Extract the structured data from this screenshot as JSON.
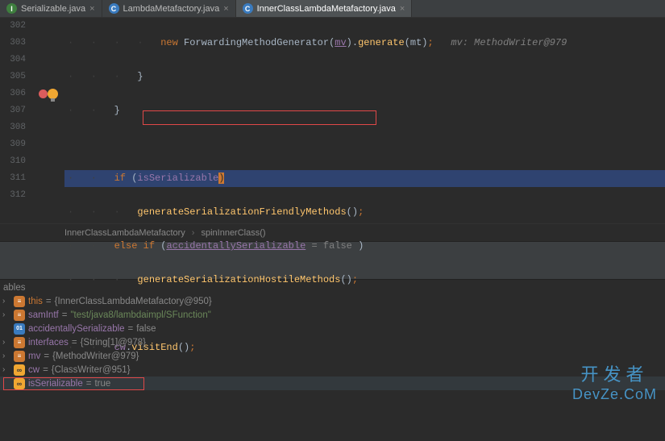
{
  "tabs": [
    {
      "label": "Serializable.java",
      "iconLetter": "I"
    },
    {
      "label": "LambdaMetafactory.java",
      "iconLetter": "C"
    },
    {
      "label": "InnerClassLambdaMetafactory.java",
      "iconLetter": "C"
    }
  ],
  "lines": {
    "l302": "302",
    "l303": "303",
    "l304": "304",
    "l305": "305",
    "l306": "306",
    "l307": "307",
    "l308": "308",
    "l309": "309",
    "l310": "310",
    "l311": "311",
    "l312": "312"
  },
  "code": {
    "newKw": "new",
    "fwdMethodGen": "ForwardingMethodGenerator",
    "mvVar": "mv",
    "generate": "generate",
    "mtVar": "mt",
    "mvComment": "mv: MethodWriter@979",
    "ifKw": "if",
    "isSerializable": "isSerializable",
    "genFriendly": "generateSerializationFriendlyMethods",
    "elseKw": "else",
    "accSerial": "accidentallySerializable",
    "falseLit": " = false ",
    "genHostile": "generateSerializationHostileMethods",
    "cwVar": "cw",
    "visitEnd": "visitEnd"
  },
  "breadcrumb": {
    "cls": "InnerClassLambdaMetafactory",
    "method": "spinInnerClass()"
  },
  "debug": {
    "header": "ables",
    "rows": [
      {
        "exp": true,
        "icon": "group",
        "iconTxt": "≡",
        "nameCls": "this",
        "name": "this",
        "eq": " = ",
        "valCls": "",
        "val": "{InnerClassLambdaMetafactory@950}"
      },
      {
        "exp": true,
        "icon": "group",
        "iconTxt": "≡",
        "nameCls": "",
        "name": "samIntf",
        "eq": " = ",
        "valCls": "str",
        "val": "\"test/java8/lambdaimpl/SFunction\""
      },
      {
        "exp": false,
        "icon": "bool",
        "iconTxt": "01",
        "nameCls": "",
        "name": "accidentallySerializable",
        "eq": " = ",
        "valCls": "",
        "val": "false"
      },
      {
        "exp": true,
        "icon": "group",
        "iconTxt": "≡",
        "nameCls": "",
        "name": "interfaces",
        "eq": " = ",
        "valCls": "",
        "val": "{String[1]@978}"
      },
      {
        "exp": true,
        "icon": "group",
        "iconTxt": "≡",
        "nameCls": "",
        "name": "mv",
        "eq": " = ",
        "valCls": "",
        "val": "{MethodWriter@979}"
      },
      {
        "exp": true,
        "icon": "inf",
        "iconTxt": "∞",
        "nameCls": "",
        "name": "cw",
        "eq": " = ",
        "valCls": "",
        "val": "{ClassWriter@951}"
      },
      {
        "exp": false,
        "icon": "inf",
        "iconTxt": "∞",
        "nameCls": "",
        "name": "isSerializable",
        "eq": " = ",
        "valCls": "true",
        "val": "true",
        "highlight": true
      }
    ]
  },
  "watermark": {
    "cn": "开发者",
    "en": "DevZe.CoM"
  }
}
